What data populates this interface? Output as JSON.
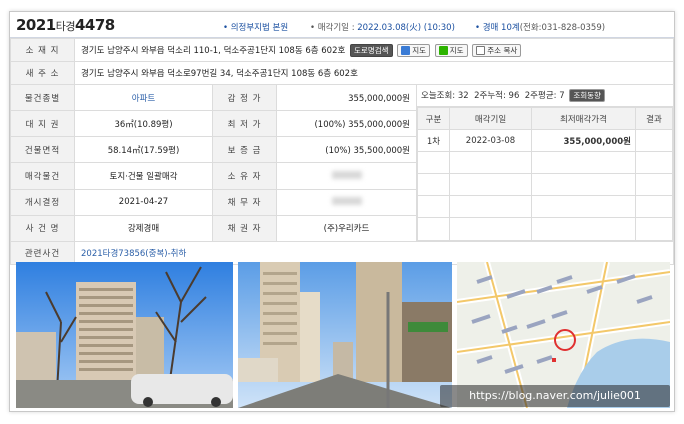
{
  "header": {
    "case_year": "2021",
    "case_type": "타경",
    "case_number": "4478",
    "court_prefix": "• ",
    "court": "의정부지법 본원",
    "date_label": "• 매각기일 : ",
    "date_value": "2022.03.08(火) (10:30)",
    "dept_prefix": "• ",
    "dept": "경매 10계",
    "phone": "(전화:031-828-0359)"
  },
  "rows": {
    "location_label": "소 재 지",
    "location_value": "경기도 남양주시 와부읍 덕소리 110-1, 덕소주공1단지 108동 6층 602호",
    "btn_road": "도로명검색",
    "btn_daum_map": "지도",
    "btn_naver_map": "지도",
    "btn_copy": "주소 복사",
    "new_address_label": "새 주 소",
    "new_address_value": "경기도 남양주시 와부읍 덕소로97번길 34, 덕소주공1단지 108동 6층 602호",
    "type_label": "물건종별",
    "type_value": "아파트",
    "appraisal_label": "감 정 가",
    "appraisal_value": "355,000,000원",
    "land_label": "대 지 권",
    "land_value": "36㎡(10.89평)",
    "min_price_label": "최 저 가",
    "min_price_value": "(100%) 355,000,000원",
    "building_label": "건물면적",
    "building_value": "58.14㎡(17.59평)",
    "deposit_label": "보 증 금",
    "deposit_value": "(10%) 35,500,000원",
    "sale_object_label": "매각물건",
    "sale_object_value": "토지·건물 일괄매각",
    "owner_label": "소 유 자",
    "start_label": "개시결정",
    "start_value": "2021-04-27",
    "debtor_label": "채 무 자",
    "case_name_label": "사 건 명",
    "case_name_value": "강제경매",
    "creditor_label": "채 권 자",
    "creditor_value": "(주)우리카드",
    "related_label": "관련사건",
    "related_value": "2021타경73856(중복)-취하"
  },
  "stats": {
    "today_label": "오늘조회: ",
    "today_value": "32",
    "two_week_label": "2주누적: ",
    "two_week_value": "96",
    "avg_label": "2주평균: ",
    "avg_value": "7",
    "btn_trend": "조회동향"
  },
  "bid_table": {
    "headers": [
      "구분",
      "매각기일",
      "최저매각가격",
      "결과"
    ],
    "rows": [
      {
        "round": "1차",
        "date": "2022-03-08",
        "price": "355,000,000원",
        "result": ""
      }
    ]
  },
  "watermark": "https://blog.naver.com/julie001",
  "colors": {
    "link": "#2b5fa8",
    "label_bg": "#f2f2f2",
    "border": "#dcdcdc"
  },
  "icons": [
    "road-search-icon",
    "daum-map-icon",
    "naver-map-icon",
    "copy-icon"
  ]
}
